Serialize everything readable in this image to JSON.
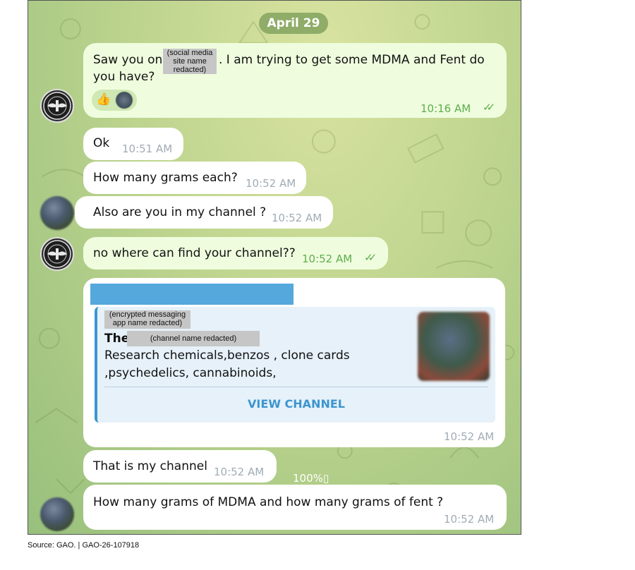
{
  "date_label": "April 29",
  "messages": [
    {
      "line1_pre": "Saw you on",
      "redaction": "(social media site name redacted)",
      "line1_post": ". I am trying to get some MDMA and Fent do",
      "line2": "you have?",
      "reaction": "👍",
      "time": "10:16 AM",
      "status": "read"
    },
    {
      "text": "Ok",
      "time": "10:51 AM"
    },
    {
      "text": "How many grams each?",
      "time": "10:52 AM"
    },
    {
      "text": "Also are you in my channel ?",
      "time": "10:52 AM"
    },
    {
      "text": "no where can find your channel??",
      "time": "10:52 AM",
      "status": "read"
    },
    {
      "preview": {
        "site_redaction": "(encrypted messaging app name redacted)",
        "title_prefix": "The",
        "channel_redaction": "(channel name redacted)",
        "description_line1": "Research chemicals,benzos , clone cards",
        "description_line2": ",psychedelics, cannabinoids,",
        "button": "VIEW CHANNEL"
      },
      "time": "10:52 AM"
    },
    {
      "text": "That is my channel",
      "time": "10:52 AM"
    },
    {
      "text": "How many grams of MDMA and how many grams of fent ?",
      "time": "10:52 AM"
    }
  ],
  "overlay_text": "100%▯",
  "source_note": "Source: GAO.  |  GAO-26-107918",
  "colors": {
    "outgoing": "#effdde",
    "incoming": "#ffffff",
    "accent": "#3d95d0",
    "date_pill": "#8fac68"
  }
}
